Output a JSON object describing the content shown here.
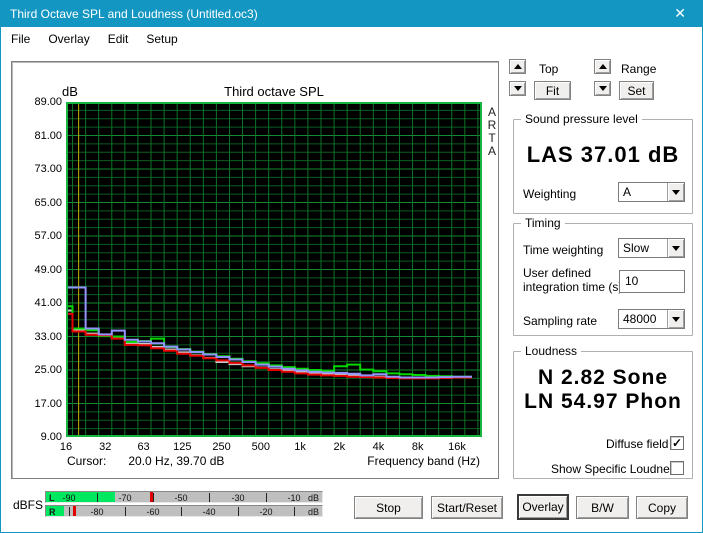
{
  "window": {
    "title": "Third Octave SPL and Loudness (Untitled.oc3)",
    "close_glyph": "✕"
  },
  "menu": {
    "items": [
      {
        "label": "File"
      },
      {
        "label": "Overlay"
      },
      {
        "label": "Edit"
      },
      {
        "label": "Setup"
      }
    ]
  },
  "view_controls": {
    "top": {
      "label": "Top",
      "button": "Fit"
    },
    "range": {
      "label": "Range",
      "button": "Set"
    }
  },
  "spl_group": {
    "title": "Sound pressure level",
    "value": "LAS 37.01 dB",
    "weighting_label": "Weighting",
    "weighting_value": "A"
  },
  "timing_group": {
    "title": "Timing",
    "time_weighting_label": "Time weighting",
    "time_weighting_value": "Slow",
    "integration_label_line1": "User defined",
    "integration_label_line2": "integration time (s)",
    "integration_value": "10",
    "sampling_label": "Sampling rate",
    "sampling_value": "48000"
  },
  "loudness_group": {
    "title": "Loudness",
    "n_value": "N 2.82 Sone",
    "ln_value": "LN 54.97 Phon",
    "diffuse_label": "Diffuse field",
    "diffuse_checked": true,
    "specific_label": "Show Specific Loudness",
    "specific_checked": false,
    "check_glyph": "✓"
  },
  "buttons": {
    "stop": "Stop",
    "start_reset": "Start/Reset",
    "overlay": "Overlay",
    "bw": "B/W",
    "copy": "Copy"
  },
  "meters": {
    "label": "dBFS",
    "unit": "dB",
    "scale": {
      "min_db": -98,
      "max_db": 0
    },
    "colors": {
      "bg": "#bfbfbf",
      "fill": "#00e760",
      "peak": "#e00000"
    },
    "rows": [
      {
        "channel": "L",
        "number_ticks": [
          -90,
          -70,
          -50,
          -30,
          -10
        ],
        "bar_ticks": [
          -80,
          -60,
          -40,
          -20
        ],
        "fill_to_db": -73.5,
        "peak_db": -61
      },
      {
        "channel": "R",
        "number_ticks": [
          -80,
          -60,
          -40,
          -20
        ],
        "bar_ticks": [
          -90,
          -70,
          -50,
          -30,
          -10
        ],
        "fill_to_db": -91.5,
        "peak_db": -88.5
      }
    ]
  },
  "chart_data": {
    "type": "line",
    "style": "third-octave stepped band spectrum",
    "title": "Third octave SPL",
    "ylabel": "dB",
    "xlabel": "Frequency band (Hz)",
    "watermark": "ARTA",
    "ylim": [
      9,
      89
    ],
    "y_major_ticks": [
      89,
      81,
      73,
      65,
      57,
      49,
      41,
      33,
      25,
      17,
      9
    ],
    "y_minor_step": 2,
    "x_tick_labels": [
      "16",
      "32",
      "63",
      "125",
      "250",
      "500",
      "1k",
      "2k",
      "4k",
      "8k",
      "16k"
    ],
    "x_tick_freqs": [
      16,
      32,
      63,
      125,
      250,
      500,
      1000,
      2000,
      4000,
      8000,
      16000
    ],
    "band_centers_hz": [
      16,
      20,
      25,
      31.5,
      40,
      50,
      63,
      80,
      100,
      125,
      160,
      200,
      250,
      315,
      400,
      500,
      630,
      800,
      1000,
      1250,
      1600,
      2000,
      2500,
      3150,
      4000,
      5000,
      6300,
      8000,
      10000,
      12500,
      16000
    ],
    "series": [
      {
        "name": "overlay-gray",
        "color": "#c8c8c8",
        "values": [
          39.2,
          34.5,
          33.7,
          33.2,
          32.6,
          31.4,
          31.2,
          30.5,
          29.9,
          29.2,
          28.5,
          27.9,
          26.9,
          26.4,
          25.9,
          25.6,
          25.2,
          24.9,
          24.6,
          24.3,
          24.1,
          24.0,
          23.8,
          23.6,
          23.4,
          23.3,
          23.2,
          23.2,
          23.2,
          23.2,
          23.2
        ]
      },
      {
        "name": "overlay-green",
        "color": "#00d800",
        "values": [
          40.2,
          34.9,
          34.5,
          33.1,
          33.0,
          31.7,
          31.9,
          32.5,
          30.5,
          30.0,
          29.4,
          28.8,
          28.3,
          27.7,
          27.1,
          26.6,
          26.1,
          25.7,
          25.3,
          25.0,
          24.8,
          25.9,
          26.3,
          25.1,
          24.7,
          24.2,
          24.0,
          23.8,
          23.6,
          23.5,
          23.4
        ]
      },
      {
        "name": "overlay-red",
        "color": "#e80000",
        "values": [
          38.4,
          34.2,
          33.4,
          33.3,
          32.5,
          31.0,
          30.9,
          30.2,
          29.6,
          28.9,
          28.4,
          27.8,
          27.3,
          26.7,
          26.1,
          25.5,
          25.0,
          24.6,
          24.2,
          23.9,
          23.7,
          23.6,
          23.4,
          23.3,
          23.2,
          23.1,
          23.0,
          23.0,
          23.0,
          23.1,
          23.2
        ]
      },
      {
        "name": "live-blue",
        "color": "#9494ff",
        "values": [
          44.7,
          44.7,
          34.9,
          33.5,
          34.4,
          32.2,
          31.8,
          31.4,
          30.6,
          29.9,
          29.3,
          28.7,
          28.1,
          27.5,
          26.9,
          26.3,
          25.8,
          25.3,
          24.9,
          24.6,
          24.4,
          24.3,
          24.1,
          23.7,
          24.0,
          23.4,
          23.2,
          23.2,
          23.2,
          23.3,
          23.4
        ]
      }
    ],
    "cursor": {
      "label": "Cursor:",
      "value": "20.0 Hz, 39.70 dB",
      "freq_hz": 20,
      "line_color": "#c9b000"
    },
    "grid": {
      "bg": "#000000",
      "minor": "#0b5e20",
      "major": "#128a2e",
      "vertical": "#0e7427",
      "border": "#17b53e"
    },
    "legend": "none"
  }
}
